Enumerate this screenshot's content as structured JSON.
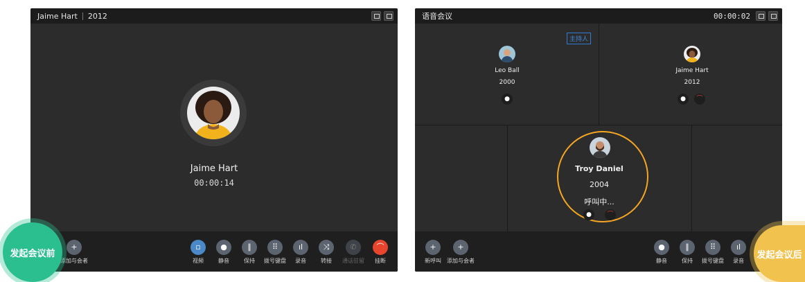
{
  "before": {
    "title_name": "Jaime Hart",
    "title_ext": "2012",
    "caller_name": "Jaime Hart",
    "duration": "00:00:14",
    "left_tool": "添加与会者",
    "tools": [
      "视频",
      "静音",
      "保持",
      "拨号键盘",
      "录音",
      "转接",
      "通话驻留",
      "挂断"
    ],
    "circle_label": "发起会议前"
  },
  "after": {
    "title": "语音会议",
    "timer": "00:00:02",
    "host_badge": "主持人",
    "participants": [
      {
        "name": "Leo Ball",
        "ext": "2000"
      },
      {
        "name": "Jaime Hart",
        "ext": "2012"
      },
      {
        "name": "Troy Daniel",
        "ext": "2004",
        "status": "呼叫中..."
      }
    ],
    "left_tools": [
      "新呼叫",
      "添加与会者"
    ],
    "tools": [
      "静音",
      "保持",
      "拨号键盘",
      "录音"
    ],
    "circle_label": "发起会议后",
    "colors": {
      "highlight": "#f5a623",
      "before_circle": "#2bbf8f",
      "after_circle": "#f2c24f"
    }
  }
}
